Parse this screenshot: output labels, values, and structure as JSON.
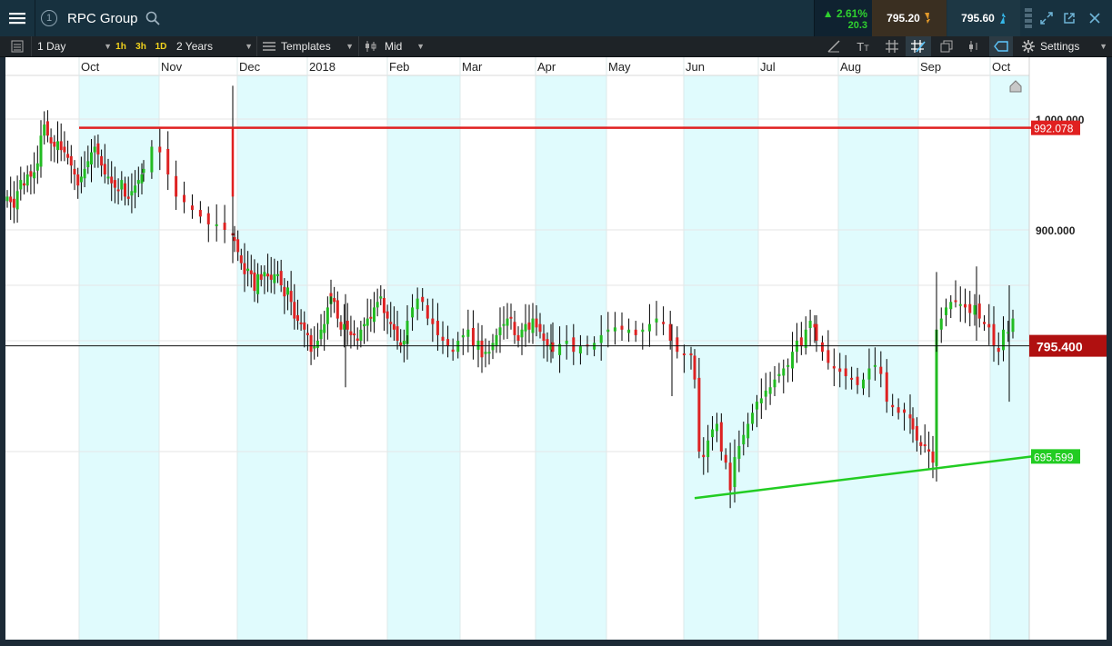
{
  "header": {
    "menu_icon": "menu-icon",
    "badge": "1",
    "instrument": "RPC Group",
    "search_icon": "search-icon",
    "change_pct": "2.61%",
    "change_abs": "20.3",
    "sell_price": "795.20",
    "buy_price": "795.60",
    "icons": [
      "signal-bars-icon",
      "expand-icon",
      "popout-icon",
      "close-icon"
    ]
  },
  "toolbar": {
    "list_icon": "list-icon",
    "interval": "1 Day",
    "quick_intervals": [
      "1h",
      "3h",
      "1D"
    ],
    "range": "2 Years",
    "templates": "Templates",
    "price_type": "Mid",
    "settings": "Settings",
    "tool_icons": [
      "draw-line-icon",
      "text-tool-icon",
      "grid-icon",
      "crosshair-icon",
      "layers-icon",
      "candle-type-icon",
      "label-icon",
      "gear-icon"
    ]
  },
  "chart_data": {
    "type": "candlestick",
    "title": "",
    "months": [
      "Oct",
      "Nov",
      "Dec",
      "2018",
      "Feb",
      "Mar",
      "Apr",
      "May",
      "Jun",
      "Jul",
      "Aug",
      "Sep",
      "Oct"
    ],
    "y_ticks": [
      "1,000.000",
      "900.000"
    ],
    "y_tick_values": [
      1000,
      900
    ],
    "ylim": [
      646,
      1045
    ],
    "horizontal_line": {
      "value": 992.078,
      "label": "992.078",
      "color": "#e02020"
    },
    "current_price": {
      "value": 795.4,
      "label": "795.400",
      "color": "#b01010"
    },
    "trendline": {
      "from": {
        "month": "Jun",
        "value": 658
      },
      "to": {
        "month": "Oct",
        "value": 695.599
      },
      "label": "695.599",
      "color": "#22cc22"
    },
    "up_color": "#22bb22",
    "down_color": "#dd2222",
    "shade_color": "#e0fbfd",
    "grid": true,
    "closes": [
      [
        930,
        925,
        920,
        935,
        945,
        940,
        950,
        948,
        952,
        960,
        985,
        995,
        985,
        978,
        975,
        980,
        972,
        970,
        965,
        958,
        950,
        940,
        948,
        955,
        962,
        970,
        975,
        968,
        958,
        950,
        948,
        942,
        938,
        935,
        945,
        930,
        928,
        935,
        940,
        945,
        950
      ],
      [
        955,
        975,
        970,
        950,
        930,
        925,
        918,
        912,
        905,
        905,
        900,
        895
      ],
      [
        890,
        880,
        870,
        860,
        865,
        860,
        845,
        860,
        855,
        862,
        858,
        855,
        860,
        860,
        850,
        840,
        848,
        835,
        820,
        818,
        815,
        810,
        805,
        790,
        795,
        800,
        810,
        815,
        830,
        840
      ],
      [
        840,
        835,
        820,
        810,
        815,
        810,
        805,
        805,
        800,
        810,
        815,
        820,
        820,
        830,
        835,
        840,
        825,
        820,
        815,
        810,
        800,
        795,
        800,
        805
      ],
      [
        818,
        830,
        838,
        835,
        820,
        815,
        805,
        800,
        795,
        790,
        800,
        805,
        810,
        795,
        795
      ],
      [
        800,
        785,
        790,
        790,
        798,
        805,
        812,
        815,
        820,
        820,
        805,
        800,
        810,
        815,
        810,
        820,
        812,
        808,
        800,
        795,
        797
      ],
      [
        790,
        797,
        800,
        790,
        795,
        795,
        798,
        805,
        810,
        812,
        810,
        810,
        805,
        810,
        815,
        820,
        815,
        800,
        790,
        787,
        788
      ],
      [
        765,
        700,
        695,
        710,
        720,
        725,
        700,
        690,
        665,
        695,
        705,
        715,
        725,
        735,
        745,
        748,
        755,
        758,
        765,
        770,
        775,
        778,
        790,
        800,
        795,
        810,
        818,
        812
      ],
      [
        800,
        790,
        780,
        775,
        772,
        768,
        766,
        760,
        765,
        775,
        778,
        770,
        745,
        740,
        735,
        735,
        730
      ],
      [
        720,
        710,
        705,
        705,
        700,
        690
      ],
      [
        810,
        820,
        830,
        835,
        836,
        833,
        830,
        825,
        832,
        820,
        815,
        812,
        795,
        790,
        810,
        808,
        820
      ]
    ],
    "bars_per_month_boundary_note": "segments start at Sep, Oct, Nov, Dec, 2018, Feb, Mar, Apr, May, Jun-Jul, Aug, Sep, Oct"
  }
}
